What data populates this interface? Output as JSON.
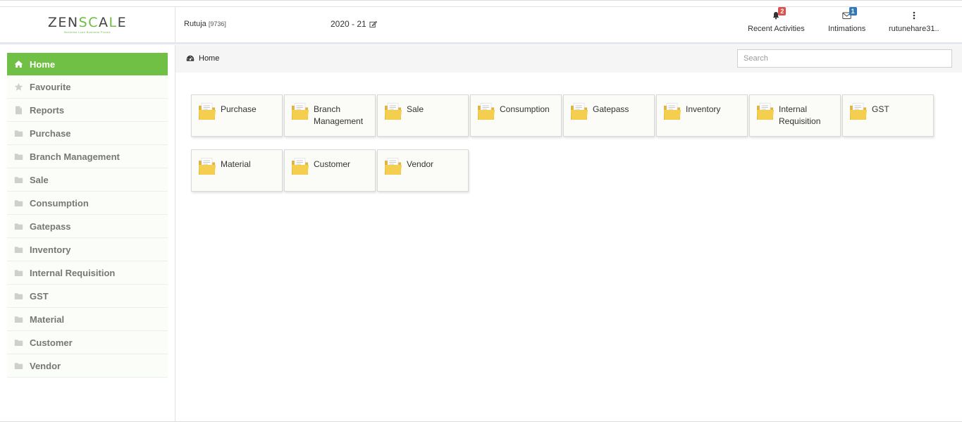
{
  "header": {
    "logo_left": "ZEN",
    "logo_green": "SC",
    "logo_mid": "A",
    "logo_right_green": "L",
    "logo_end": "E",
    "logo_tagline": "Business Loan Business Proces",
    "user_name": "Rutuja",
    "user_code": "[9736]",
    "year": "2020 - 21",
    "recent_activities": {
      "label": "Recent Activities",
      "count": "2",
      "badge_color": "#d9534f"
    },
    "intimations": {
      "label": "Intimations",
      "count": "1",
      "badge_color": "#337ab7"
    },
    "account": {
      "label": "rutunehare31.."
    }
  },
  "breadcrumb": {
    "label": "Home"
  },
  "search": {
    "placeholder": "Search"
  },
  "sidebar": {
    "items": [
      {
        "label": "Home",
        "icon": "home-icon"
      },
      {
        "label": "Favourite",
        "icon": "star-icon"
      },
      {
        "label": "Reports",
        "icon": "file-icon"
      },
      {
        "label": "Purchase",
        "icon": "folder-icon"
      },
      {
        "label": "Branch Management",
        "icon": "folder-icon"
      },
      {
        "label": "Sale",
        "icon": "folder-icon"
      },
      {
        "label": "Consumption",
        "icon": "folder-icon"
      },
      {
        "label": "Gatepass",
        "icon": "folder-icon"
      },
      {
        "label": "Inventory",
        "icon": "folder-icon"
      },
      {
        "label": "Internal Requisition",
        "icon": "folder-icon"
      },
      {
        "label": "GST",
        "icon": "folder-icon"
      },
      {
        "label": "Material",
        "icon": "folder-icon"
      },
      {
        "label": "Customer",
        "icon": "folder-icon"
      },
      {
        "label": "Vendor",
        "icon": "folder-icon"
      }
    ]
  },
  "tiles": [
    {
      "label": "Purchase"
    },
    {
      "label": "Branch Management"
    },
    {
      "label": "Sale"
    },
    {
      "label": "Consumption"
    },
    {
      "label": "Gatepass"
    },
    {
      "label": "Inventory"
    },
    {
      "label": "Internal Requisition"
    },
    {
      "label": "GST"
    },
    {
      "label": "Material"
    },
    {
      "label": "Customer"
    },
    {
      "label": "Vendor"
    }
  ],
  "colors": {
    "accent": "#6fc044",
    "folder": "#f3ce4f"
  }
}
